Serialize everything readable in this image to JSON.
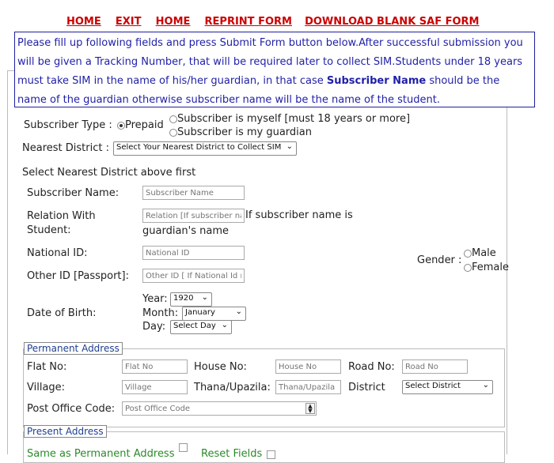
{
  "nav": {
    "home1": "HOME",
    "exit": "EXIT",
    "home2": "HOME",
    "reprint": "REPRINT FORM",
    "download": "DOWNLOAD BLANK SAF FORM"
  },
  "info": {
    "part1": "Please fill up following fields and press Submit Form button below.After successful submission you will be given a Tracking Number, that will be required later to collect SIM.Students under 18 years must take SIM in the name of his/her guardian, in that case ",
    "bold": "Subscriber Name",
    "part2": " should be the name of the guardian otherwise subscriber name will be the name of the student."
  },
  "subscriber_type": {
    "label": "Subscriber Type :",
    "prepaid": "Prepaid",
    "opt_myself": "Subscriber is myself [must 18 years or more]",
    "opt_guardian": "Subscriber is my guardian"
  },
  "district": {
    "label": "Nearest District :",
    "value": "Select Your Nearest District to Collect SIM",
    "hint": "Select Nearest District above first"
  },
  "fields": {
    "name_label": "Subscriber Name:",
    "name_ph": "Subscriber Name",
    "relation_label1": "Relation With",
    "relation_label2": "Student:",
    "relation_ph": "Relation [If subscriber na",
    "relation_note1": "If subscriber name is",
    "relation_note2": "guardian's name",
    "nid_label": "National ID:",
    "nid_ph": "National ID",
    "other_label": "Other ID [Passport]:",
    "other_ph": "Other ID [ If National Id no",
    "gender_label": "Gender :",
    "male": "Male",
    "female": "Female",
    "dob_label": "Date of Birth:",
    "year_label": "Year:",
    "year_value": "1920",
    "month_label": "Month:",
    "month_value": "January",
    "day_label": "Day:",
    "day_value": "Select Day"
  },
  "permanent": {
    "legend": "Permanent Address",
    "flat_label": "Flat No:",
    "flat_ph": "Flat No",
    "house_label": "House No:",
    "house_ph": "House No",
    "road_label": "Road No:",
    "road_ph": "Road No",
    "village_label": "Village:",
    "village_ph": "Village",
    "thana_label": "Thana/Upazila:",
    "thana_ph": "Thana/Upazila",
    "district_label": "District",
    "district_value": "Select District",
    "post_label": "Post Office Code:",
    "post_ph": "Post Office Code"
  },
  "present": {
    "legend": "Present Address",
    "same_label": "Same as Permanent Address",
    "reset_label": "Reset Fields"
  }
}
